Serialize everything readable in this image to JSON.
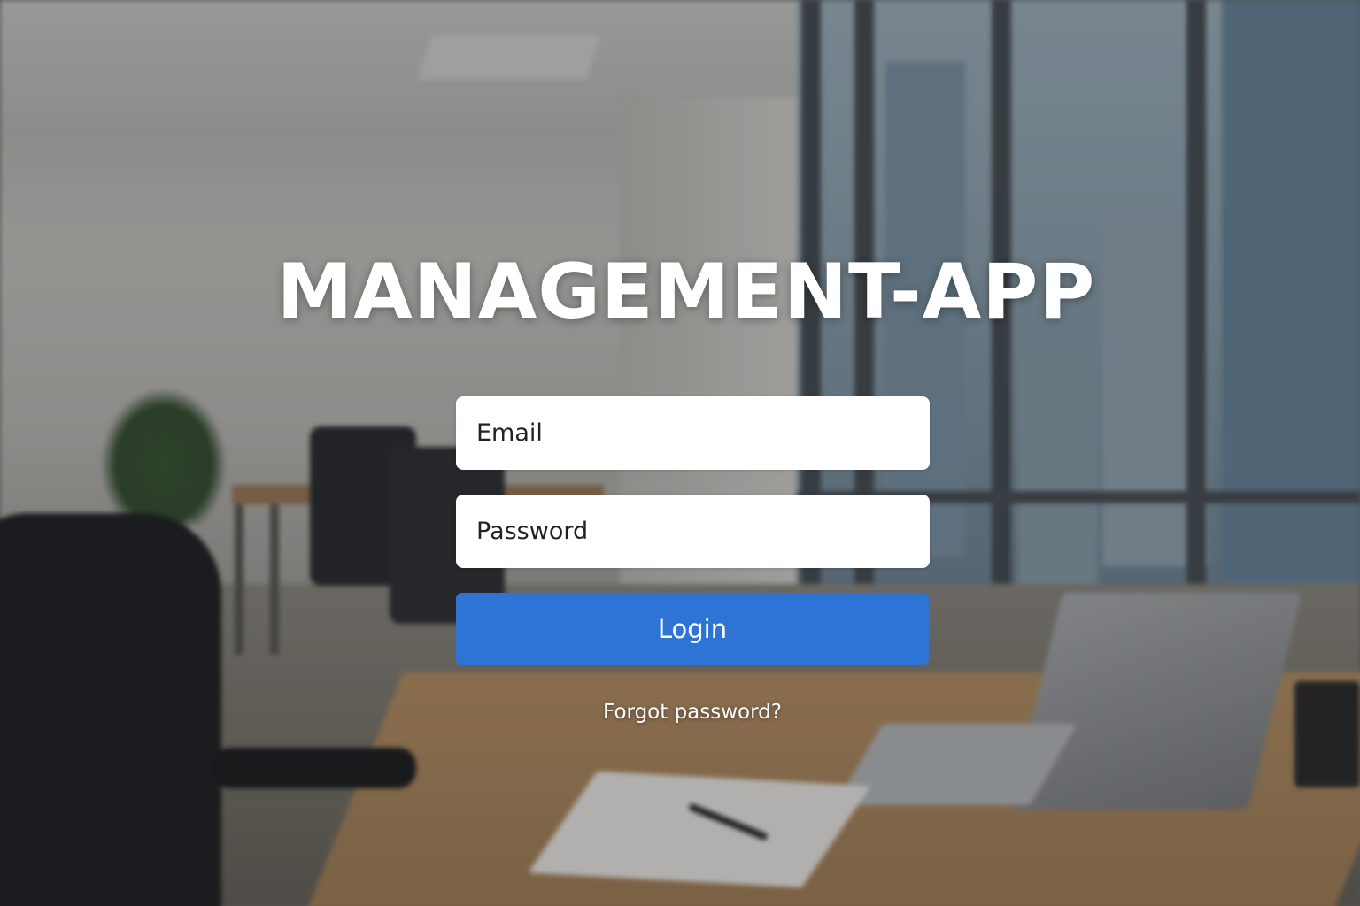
{
  "app": {
    "title": "MANAGEMENT-APP"
  },
  "login_form": {
    "email_placeholder": "Email",
    "password_placeholder": "Password",
    "login_label": "Login",
    "forgot_password_label": "Forgot password?"
  },
  "colors": {
    "login_button": "#2d74d5",
    "title_text": "#ffffff",
    "field_background": "#ffffff"
  }
}
